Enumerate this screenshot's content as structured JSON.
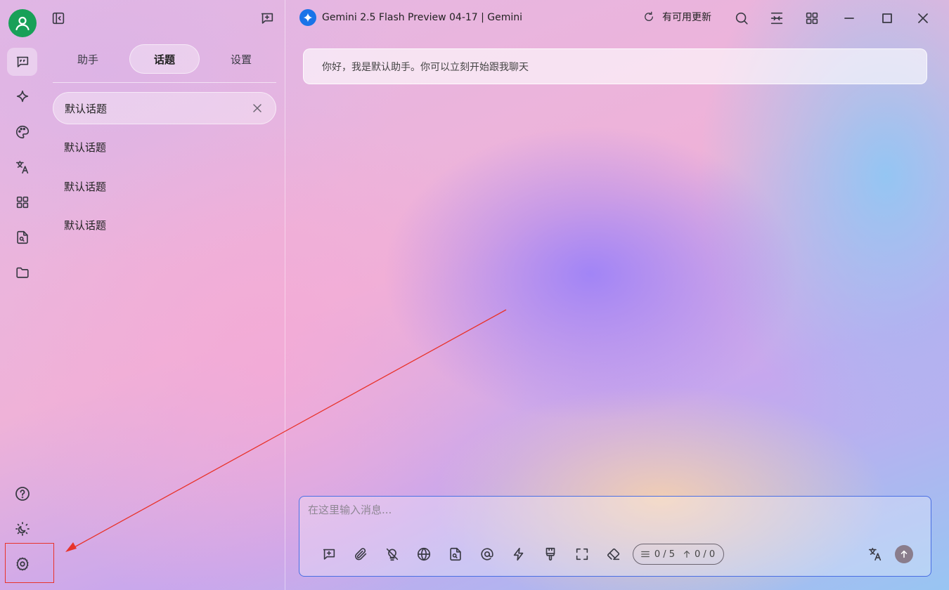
{
  "header": {
    "model_title": "Gemini 2.5 Flash Preview 04-17 | Gemini",
    "update_label": "有可用更新"
  },
  "sidebar_tabs": [
    "助手",
    "话题",
    "设置"
  ],
  "active_tab": "话题",
  "topics": [
    {
      "label": "默认话题"
    },
    {
      "label": "默认话题"
    },
    {
      "label": "默认话题"
    },
    {
      "label": "默认话题"
    }
  ],
  "chat": {
    "greeting": "你好，我是默认助手。你可以立刻开始跟我聊天"
  },
  "composer": {
    "placeholder": "在这里输入消息...",
    "token_count": "0 / 5",
    "upload_count": "0 / 0"
  },
  "colors": {
    "avatar": "#18a058",
    "highlight": "#e8332b",
    "composer_border": "#4a6fe3",
    "model_logo": "#1a73e8"
  },
  "icons": {
    "rail": [
      "chat-icon",
      "sparkle-icon",
      "palette-icon",
      "translate-icon",
      "apps-icon",
      "file-search-icon",
      "folder-icon"
    ],
    "rail_bottom": [
      "help-icon",
      "theme-icon",
      "gear-icon"
    ]
  }
}
